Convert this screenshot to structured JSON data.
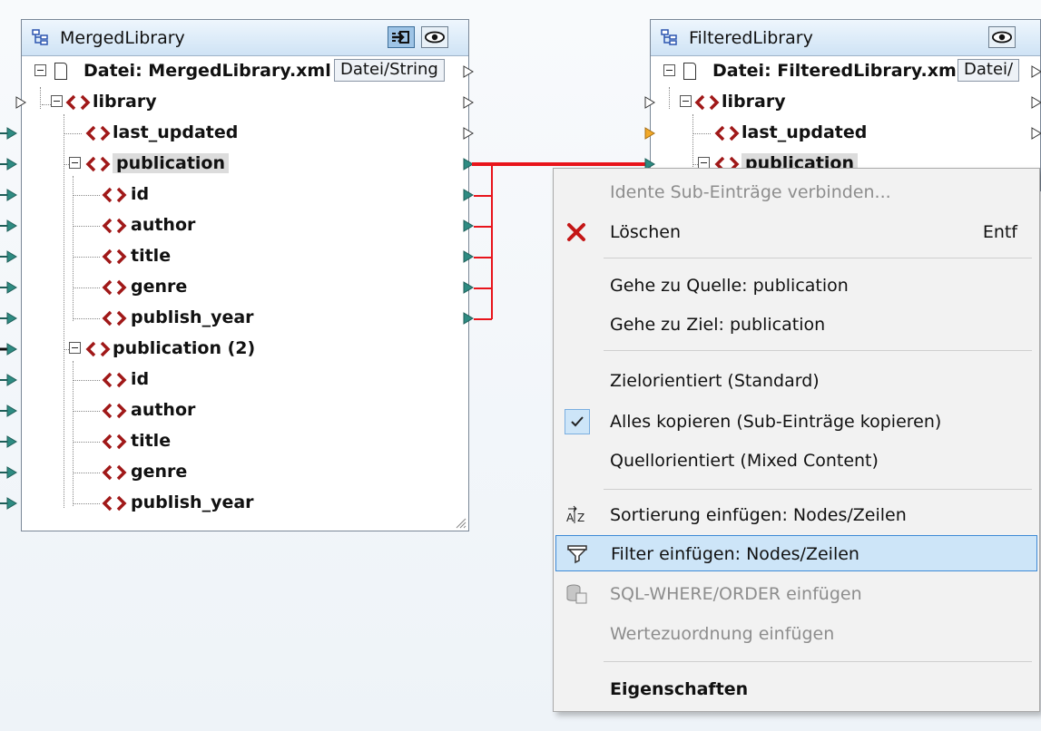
{
  "source_component": {
    "title": "MergedLibrary",
    "file_label": "Datei: MergedLibrary.xml",
    "file_button": "Datei/String",
    "nodes": {
      "library": "library",
      "last_updated": "last_updated",
      "publication": "publication",
      "id": "id",
      "author": "author",
      "title": "title",
      "genre": "genre",
      "publish_year": "publish_year",
      "publication2": "publication (2)",
      "id2": "id",
      "author2": "author",
      "title2": "title",
      "genre2": "genre",
      "publish_year2": "publish_year"
    }
  },
  "target_component": {
    "title": "FilteredLibrary",
    "file_label": "Datei: FilteredLibrary.xml",
    "file_button": "Datei/",
    "nodes": {
      "library": "library",
      "last_updated": "last_updated",
      "publication": "publication"
    }
  },
  "context_menu": {
    "items": [
      {
        "label": "Idente Sub-Einträge verbinden...",
        "enabled": false
      },
      {
        "label": "Löschen",
        "shortcut": "Entf",
        "icon": "delete-x-icon"
      },
      {
        "label": "Gehe zu Quelle: publication"
      },
      {
        "label": "Gehe zu Ziel: publication"
      },
      {
        "label": "Zielorientiert (Standard)"
      },
      {
        "label": "Alles kopieren (Sub-Einträge kopieren)",
        "checked": true
      },
      {
        "label": "Quellorientiert (Mixed Content)"
      },
      {
        "label": "Sortierung einfügen: Nodes/Zeilen",
        "icon": "sort-az-icon"
      },
      {
        "label": "Filter einfügen: Nodes/Zeilen",
        "icon": "filter-funnel-icon",
        "highlighted": true
      },
      {
        "label": "SQL-WHERE/ORDER einfügen",
        "icon": "sql-where-icon",
        "enabled": false
      },
      {
        "label": "Wertezuordnung einfügen",
        "enabled": false
      },
      {
        "label": "Eigenschaften",
        "bold": true
      }
    ]
  },
  "colors": {
    "connection_line": "#e8141b",
    "port_fill": "#2e8b82",
    "tag_icon": "#a01818",
    "menu_highlight": "#cde5f8",
    "selected_node_bg": "#dcdcdc"
  }
}
